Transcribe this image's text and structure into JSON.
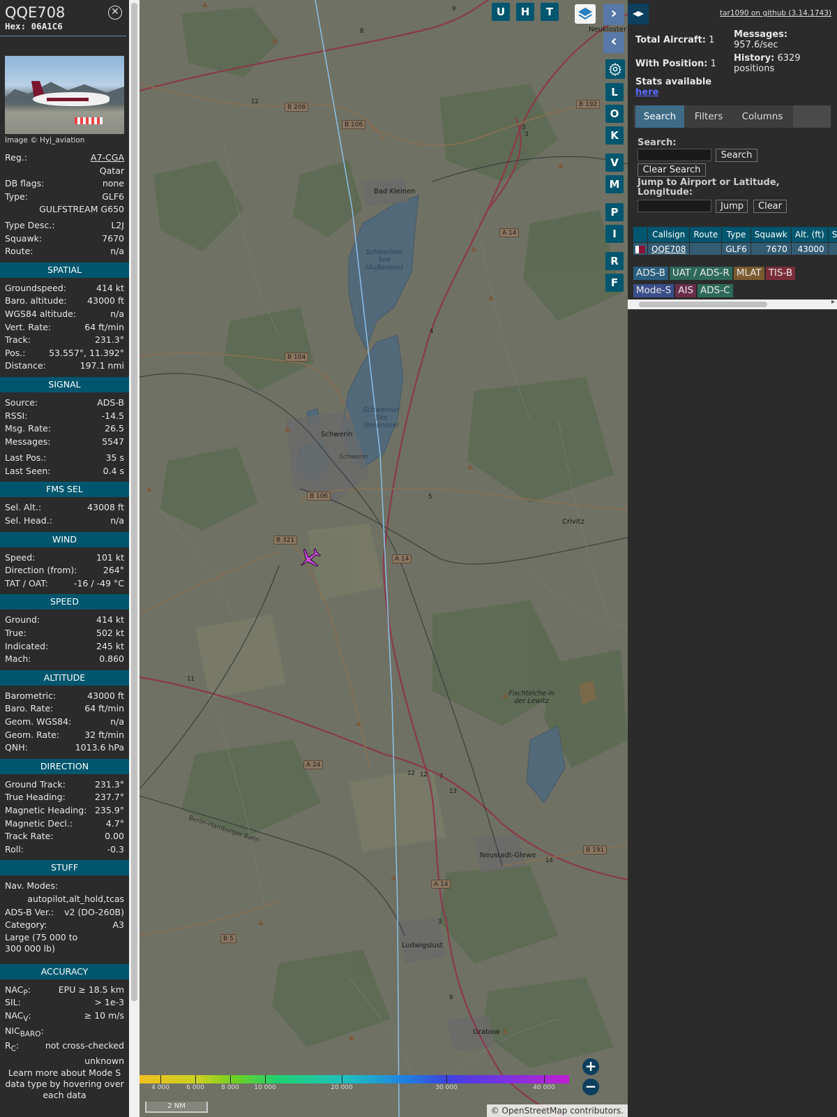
{
  "aircraft": {
    "callsign": "QQE708",
    "hex_label": "Hex:",
    "hex": "06A1C6"
  },
  "photo_credit": "Image © Hyj_aviation",
  "details": [
    {
      "k": "Reg.:",
      "v": "A7-CGA"
    },
    {
      "k": "",
      "v": "Qatar"
    },
    {
      "k": "DB flags:",
      "v": "none"
    },
    {
      "k": "Type:",
      "v": "GLF6"
    },
    {
      "k": "",
      "v": "GULFSTREAM G650"
    },
    {
      "k": "Type Desc.:",
      "v": "L2J"
    },
    {
      "k": "Squawk:",
      "v": "7670"
    },
    {
      "k": "Route:",
      "v": "n/a"
    }
  ],
  "sections": [
    {
      "title": "SPATIAL",
      "rows": [
        {
          "k": "Groundspeed:",
          "v": "414 kt"
        },
        {
          "k": "Baro. altitude:",
          "v": "43000 ft"
        },
        {
          "k": "WGS84 altitude:",
          "v": "n/a"
        },
        {
          "k": "Vert. Rate:",
          "v": "64 ft/min"
        },
        {
          "k": "Track:",
          "v": "231.3°"
        },
        {
          "k": "Pos.:",
          "v": "53.557°, 11.392°"
        },
        {
          "k": "Distance:",
          "v": "197.1 nmi"
        }
      ]
    },
    {
      "title": "SIGNAL",
      "rows": [
        {
          "k": "Source:",
          "v": "ADS-B"
        },
        {
          "k": "RSSI:",
          "v": "-14.5"
        },
        {
          "k": "Msg. Rate:",
          "v": "26.5"
        },
        {
          "k": "Messages:",
          "v": "5547"
        },
        {
          "k": "Last Pos.:",
          "v": "35 s"
        },
        {
          "k": "Last Seen:",
          "v": "0.4 s"
        }
      ]
    },
    {
      "title": "FMS SEL",
      "rows": [
        {
          "k": "Sel. Alt.:",
          "v": "43008 ft"
        },
        {
          "k": "Sel. Head.:",
          "v": "n/a"
        }
      ]
    },
    {
      "title": "WIND",
      "rows": [
        {
          "k": "Speed:",
          "v": "101 kt"
        },
        {
          "k": "Direction (from):",
          "v": "264°"
        },
        {
          "k": "TAT / OAT:",
          "v": "-16 / -49 °C"
        }
      ]
    },
    {
      "title": "SPEED",
      "rows": [
        {
          "k": "Ground:",
          "v": "414 kt"
        },
        {
          "k": "True:",
          "v": "502 kt"
        },
        {
          "k": "Indicated:",
          "v": "245 kt"
        },
        {
          "k": "Mach:",
          "v": "0.860"
        }
      ]
    },
    {
      "title": "ALTITUDE",
      "rows": [
        {
          "k": "Barometric:",
          "v": "43000 ft"
        },
        {
          "k": "Baro. Rate:",
          "v": "64 ft/min"
        },
        {
          "k": "Geom. WGS84:",
          "v": "n/a"
        },
        {
          "k": "Geom. Rate:",
          "v": "32 ft/min"
        },
        {
          "k": "QNH:",
          "v": "1013.6 hPa"
        }
      ]
    },
    {
      "title": "DIRECTION",
      "rows": [
        {
          "k": "Ground Track:",
          "v": "231.3°"
        },
        {
          "k": "True Heading:",
          "v": "237.7°"
        },
        {
          "k": "Magnetic Heading:",
          "v": "235.9°"
        },
        {
          "k": "Magnetic Decl.:",
          "v": "4.7°"
        },
        {
          "k": "Track Rate:",
          "v": "0.00"
        },
        {
          "k": "Roll:",
          "v": "-0.3"
        }
      ]
    }
  ],
  "stuff": {
    "title": "STUFF",
    "nav_modes_label": "Nav. Modes:",
    "nav_modes": "autopilot,alt_hold,tcas",
    "adsb_ver_label": "ADS-B Ver.:",
    "adsb_ver": "v2 (DO-260B)",
    "category_label": "Category:",
    "category": "A3",
    "category_desc": "Large (75 000 to 300 000 lb)"
  },
  "accuracy": {
    "title": "ACCURACY",
    "nacp_label": "NAC",
    "nacp_sub": "P",
    "nacp": "EPU ≥ 18.5 km",
    "sil_label": "SIL:",
    "sil": "> 1e-3",
    "nacv_label": "NAC",
    "nacv_sub": "V",
    "nacv": "≥ 10 m/s",
    "nicbaro_label": "NIC",
    "nicbaro_sub": "BARO",
    "rc_label": "R",
    "rc_sub": "C",
    "rc": "not cross-checked",
    "rc2": "unknown",
    "learn_more": "Learn more about Mode S data type by hovering over each data"
  },
  "map": {
    "buttons_top": [
      "U",
      "H",
      "T"
    ],
    "buttons_side": [
      "L",
      "O",
      "K",
      "V",
      "M",
      "P",
      "I",
      "R",
      "F"
    ],
    "zoom_in": "+",
    "zoom_out": "−",
    "attribution_prefix": "© ",
    "attribution_link": "OpenStreetMap",
    "attribution_suffix": " contributors.",
    "scale": "2 NM",
    "legend": [
      "4 000",
      "6 000",
      "8 000",
      "10 000",
      "20 000",
      "30 000",
      "40 000"
    ],
    "roads": [
      "B 208",
      "B 106",
      "B 192",
      "A 14",
      "B 104",
      "B 106",
      "B 321",
      "A 14",
      "A 24",
      "B 191",
      "A 14",
      "B 5"
    ],
    "towns": [
      "Neukloster",
      "Bad Kleinen",
      "Schwerin",
      "Schwerin",
      "Crivitz",
      "Neustadt-Glewe",
      "Ludwigslust",
      "Grabow",
      "Berlin-Hamburger Bahn"
    ],
    "lakes": [
      "Schweriner See (Außensee)",
      "Schweriner See (Innensee)",
      "Fischteiche in der Lewitz"
    ],
    "road_numbers": [
      "9",
      "8",
      "3",
      "3",
      "4",
      "5",
      "12",
      "12",
      "7",
      "13",
      "14",
      "3",
      "9",
      "12",
      "11"
    ]
  },
  "sidebar": {
    "github": "tar1090 on github (3.14.1743)",
    "total_label": "Total Aircraft:",
    "total": "1",
    "withpos_label": "With Position:",
    "withpos": "1",
    "messages_label": "Messages:",
    "messages": "957.6/sec",
    "history_label": "History:",
    "history": "6329 positions",
    "stats_label": "Stats available",
    "stats_link": "here",
    "tabs": [
      "Search",
      "Filters",
      "Columns"
    ],
    "search_label": "Search:",
    "search_btn": "Search",
    "clear_search_btn": "Clear Search",
    "jump_label": "Jump to Airport or Latitude, Longitude:",
    "jump_btn": "Jump",
    "clear_btn": "Clear",
    "columns": [
      "Callsign",
      "Route",
      "Type",
      "Squawk",
      "Alt. (ft)",
      "Spd."
    ],
    "row": {
      "callsign": "QQE708",
      "route": "",
      "type": "GLF6",
      "squawk": "7670",
      "alt": "43000",
      "spd": ""
    },
    "badges": [
      {
        "label": "ADS-B",
        "bg": "#2a5f7f"
      },
      {
        "label": "UAT / ADS-R",
        "bg": "#2e6a5a"
      },
      {
        "label": "MLAT",
        "bg": "#7a5a2e"
      },
      {
        "label": "TIS-B",
        "bg": "#7a2e3a"
      },
      {
        "label": "Mode-S",
        "bg": "#3a4f8a"
      },
      {
        "label": "AIS",
        "bg": "#6a2e4a"
      },
      {
        "label": "ADS-C",
        "bg": "#2e6a5a"
      }
    ]
  }
}
